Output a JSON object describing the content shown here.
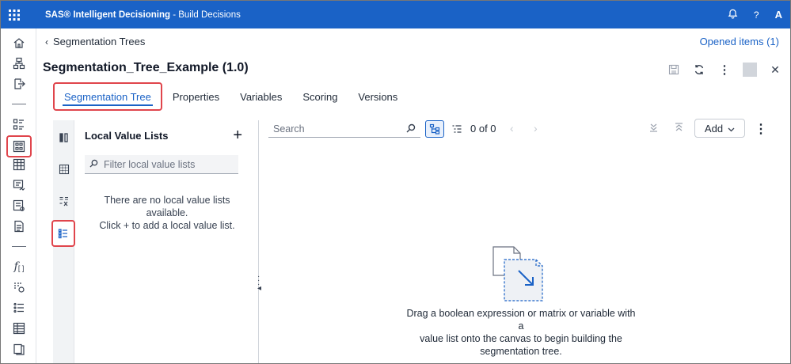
{
  "app": {
    "brand": "SAS® Intelligent Decisioning",
    "section": "- Build Decisions",
    "avatar": "A",
    "help": "?"
  },
  "breadcrumb": {
    "label": "Segmentation Trees"
  },
  "opened_items": "Opened items (1)",
  "document": {
    "title": "Segmentation_Tree_Example (1.0)"
  },
  "tabs": [
    {
      "label": "Segmentation Tree"
    },
    {
      "label": "Properties"
    },
    {
      "label": "Variables"
    },
    {
      "label": "Scoring"
    },
    {
      "label": "Versions"
    }
  ],
  "local_values": {
    "title": "Local Value Lists",
    "add": "+",
    "filter_placeholder": "Filter local value lists",
    "empty_line1": "There are no local value lists",
    "empty_line2": "available.",
    "empty_line3": "Click + to add a local value list."
  },
  "canvas": {
    "search_placeholder": "Search",
    "count": "0 of 0",
    "add_label": "Add",
    "empty_line1": "Drag a boolean expression or matrix or variable with a",
    "empty_line2": "value list onto the canvas to begin building the",
    "empty_line3": "segmentation tree."
  },
  "colors": {
    "topbar": "#1a62c6",
    "accent": "#1a62c6",
    "highlight": "#e0454c"
  }
}
